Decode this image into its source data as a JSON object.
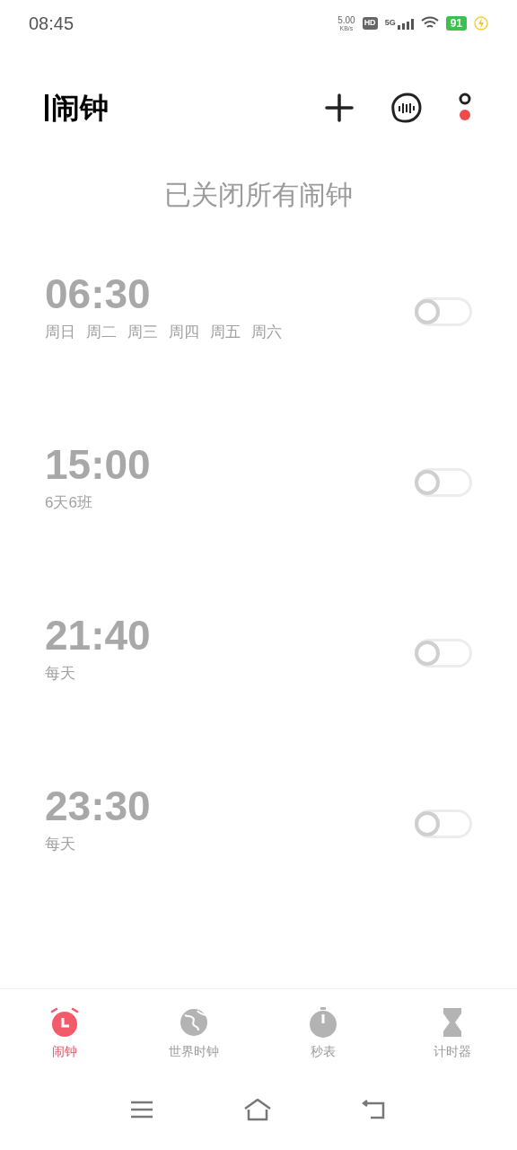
{
  "status_bar": {
    "time": "08:45",
    "speed": "5.00",
    "speed_unit": "KB/s",
    "hd": "HD",
    "network": "5G",
    "battery": "91"
  },
  "header": {
    "title": "闹钟"
  },
  "notice": "已关闭所有闹钟",
  "alarms": [
    {
      "time": "06:30",
      "repeat": [
        "周日",
        "周二",
        "周三",
        "周四",
        "周五",
        "周六"
      ],
      "on": false
    },
    {
      "time": "15:00",
      "repeat": [
        "6天6班"
      ],
      "on": false
    },
    {
      "time": "21:40",
      "repeat": [
        "每天"
      ],
      "on": false
    },
    {
      "time": "23:30",
      "repeat": [
        "每天"
      ],
      "on": false
    }
  ],
  "tabs": [
    {
      "kind": "alarm",
      "label": "闹钟",
      "selected": true
    },
    {
      "kind": "world",
      "label": "世界时钟",
      "selected": false
    },
    {
      "kind": "stopwatch",
      "label": "秒表",
      "selected": false
    },
    {
      "kind": "timer",
      "label": "计时器",
      "selected": false
    }
  ]
}
